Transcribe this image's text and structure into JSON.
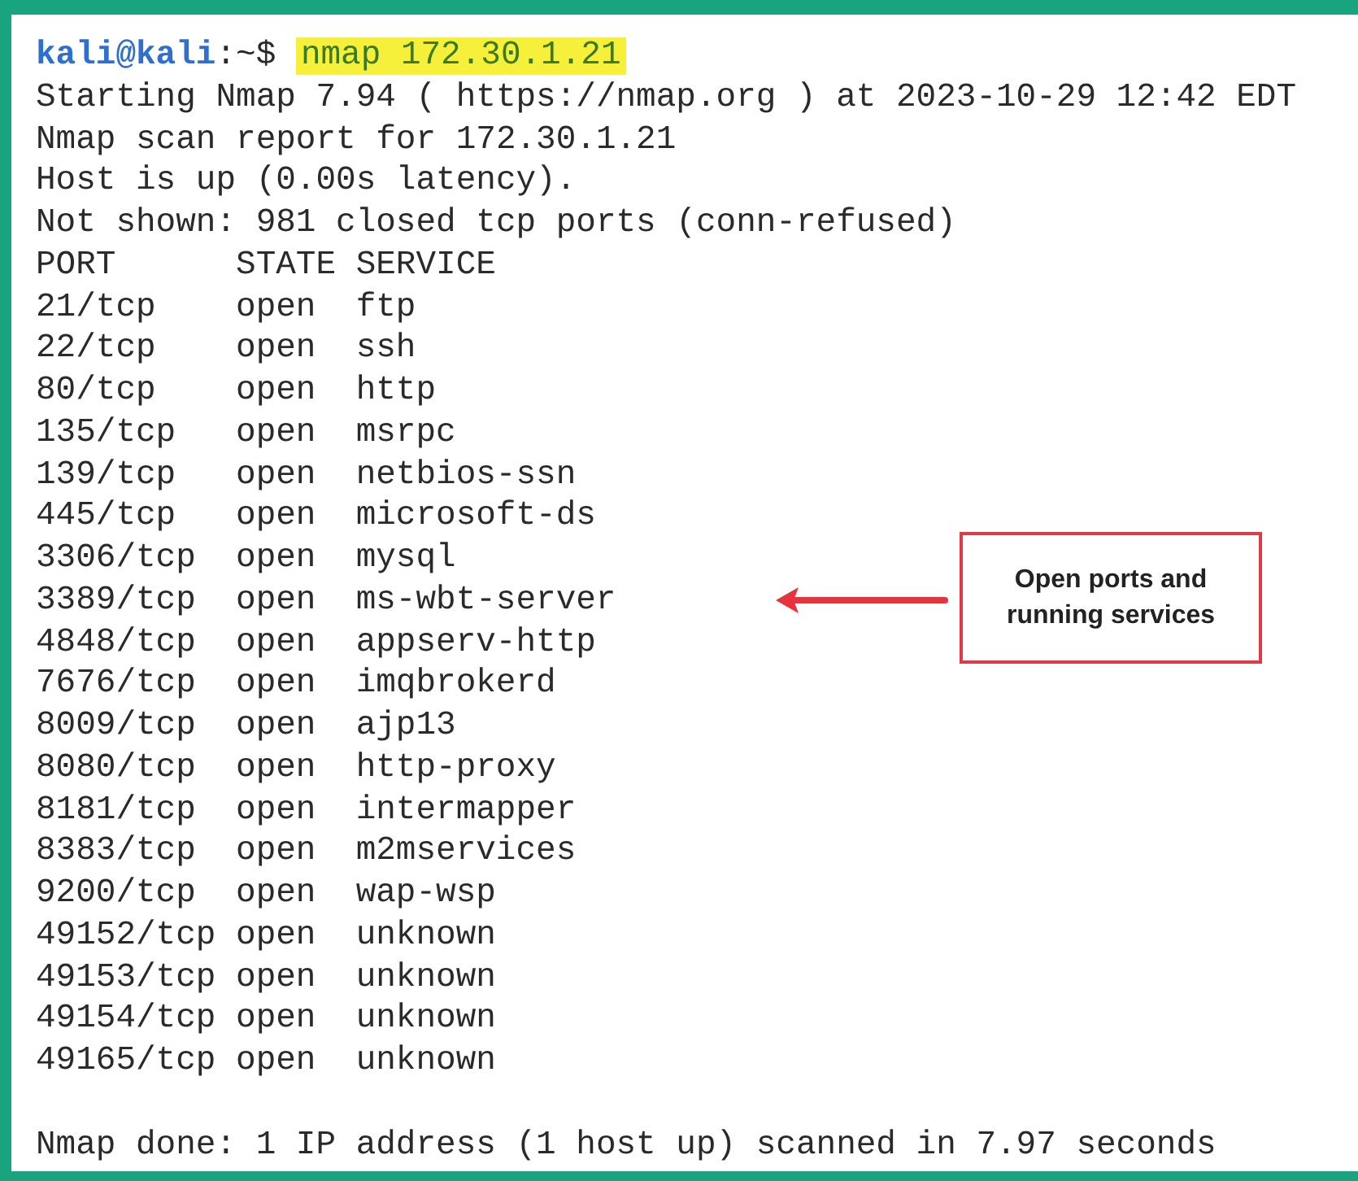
{
  "prompt": {
    "user": "kali@kali",
    "path": ":~$",
    "command": "nmap 172.30.1.21"
  },
  "header_lines": [
    "Starting Nmap 7.94 ( https://nmap.org ) at 2023-10-29 12:42 EDT",
    "Nmap scan report for 172.30.1.21",
    "Host is up (0.00s latency).",
    "Not shown: 981 closed tcp ports (conn-refused)"
  ],
  "table": {
    "columns": [
      "PORT",
      "STATE",
      "SERVICE"
    ],
    "rows": [
      {
        "port": "21/tcp",
        "state": "open",
        "service": "ftp"
      },
      {
        "port": "22/tcp",
        "state": "open",
        "service": "ssh"
      },
      {
        "port": "80/tcp",
        "state": "open",
        "service": "http"
      },
      {
        "port": "135/tcp",
        "state": "open",
        "service": "msrpc"
      },
      {
        "port": "139/tcp",
        "state": "open",
        "service": "netbios-ssn"
      },
      {
        "port": "445/tcp",
        "state": "open",
        "service": "microsoft-ds"
      },
      {
        "port": "3306/tcp",
        "state": "open",
        "service": "mysql"
      },
      {
        "port": "3389/tcp",
        "state": "open",
        "service": "ms-wbt-server"
      },
      {
        "port": "4848/tcp",
        "state": "open",
        "service": "appserv-http"
      },
      {
        "port": "7676/tcp",
        "state": "open",
        "service": "imqbrokerd"
      },
      {
        "port": "8009/tcp",
        "state": "open",
        "service": "ajp13"
      },
      {
        "port": "8080/tcp",
        "state": "open",
        "service": "http-proxy"
      },
      {
        "port": "8181/tcp",
        "state": "open",
        "service": "intermapper"
      },
      {
        "port": "8383/tcp",
        "state": "open",
        "service": "m2mservices"
      },
      {
        "port": "9200/tcp",
        "state": "open",
        "service": "wap-wsp"
      },
      {
        "port": "49152/tcp",
        "state": "open",
        "service": "unknown"
      },
      {
        "port": "49153/tcp",
        "state": "open",
        "service": "unknown"
      },
      {
        "port": "49154/tcp",
        "state": "open",
        "service": "unknown"
      },
      {
        "port": "49165/tcp",
        "state": "open",
        "service": "unknown"
      }
    ]
  },
  "footer": "Nmap done: 1 IP address (1 host up) scanned in 7.97 seconds",
  "callout": {
    "text": "Open ports and running services"
  }
}
